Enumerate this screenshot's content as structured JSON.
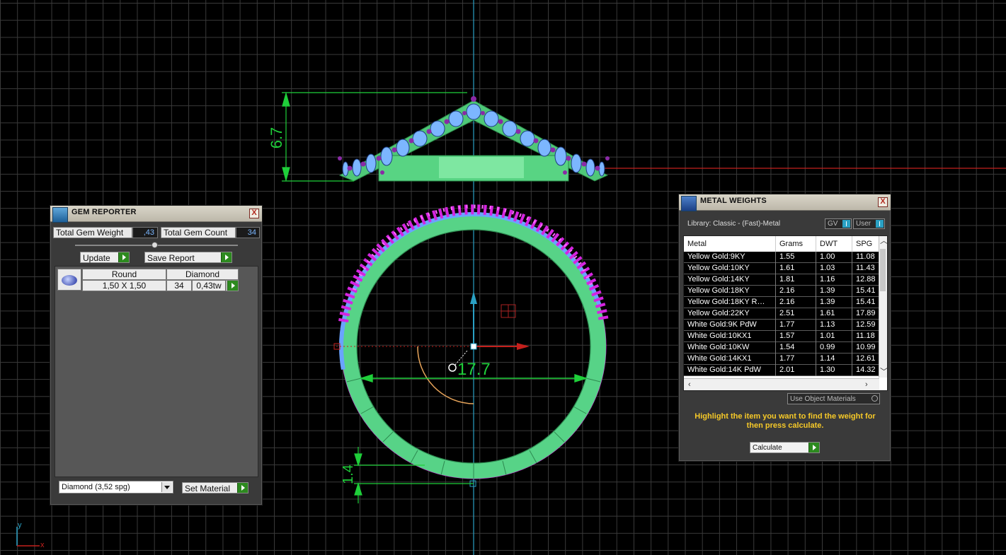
{
  "viewport": {
    "dimensions": {
      "height": "6.7",
      "diameter": "17.7",
      "thickness": "1.4"
    },
    "axes": {
      "y": "y",
      "x": "x"
    },
    "colors": {
      "dimension": "#1fcf3a",
      "ring_body": "#5fd88a",
      "gem_prongs": "#d524e0",
      "gems": "#6aa3ff",
      "x_axis": "#c4201c",
      "y_axis": "#2aa1c4"
    }
  },
  "gem_reporter": {
    "title": "GEM REPORTER",
    "close": "X",
    "total_weight_label": "Total Gem Weight",
    "total_weight_value": ",43",
    "total_count_label": "Total Gem Count",
    "total_count_value": "34",
    "update_label": "Update",
    "save_report_label": "Save Report",
    "gem_row": {
      "shape": "Round",
      "material": "Diamond",
      "size": "1,50 X 1,50",
      "count": "34",
      "weight": "0,43tw"
    },
    "material_select": "Diamond    (3,52 spg)",
    "set_material_label": "Set Material"
  },
  "metal_weights": {
    "title": "METAL WEIGHTS",
    "close": "X",
    "library": "Library: Classic - (Fast)-Metal",
    "gv_label": "GV",
    "user_label": "User",
    "columns": [
      "Metal",
      "Grams",
      "DWT",
      "SPG"
    ],
    "rows": [
      [
        "Yellow Gold:9KY",
        "1.55",
        "1.00",
        "11.08"
      ],
      [
        "Yellow Gold:10KY",
        "1.61",
        "1.03",
        "11.43"
      ],
      [
        "Yellow Gold:14KY",
        "1.81",
        "1.16",
        "12.88"
      ],
      [
        "Yellow Gold:18KY",
        "2.16",
        "1.39",
        "15.41"
      ],
      [
        "Yellow Gold:18KY R…",
        "2.16",
        "1.39",
        "15.41"
      ],
      [
        "Yellow Gold:22KY",
        "2.51",
        "1.61",
        "17.89"
      ],
      [
        "White Gold:9K PdW",
        "1.77",
        "1.13",
        "12.59"
      ],
      [
        "White Gold:10KX1",
        "1.57",
        "1.01",
        "11.18"
      ],
      [
        "White Gold:10KW",
        "1.54",
        "0.99",
        "10.99"
      ],
      [
        "White Gold:14KX1",
        "1.77",
        "1.14",
        "12.61"
      ],
      [
        "White Gold:14K PdW",
        "2.01",
        "1.30",
        "14.32"
      ]
    ],
    "use_object_materials": "Use Object Materials",
    "hint": "Highlight the item you want to find the weight for then press calculate.",
    "calculate_label": "Calculate"
  }
}
